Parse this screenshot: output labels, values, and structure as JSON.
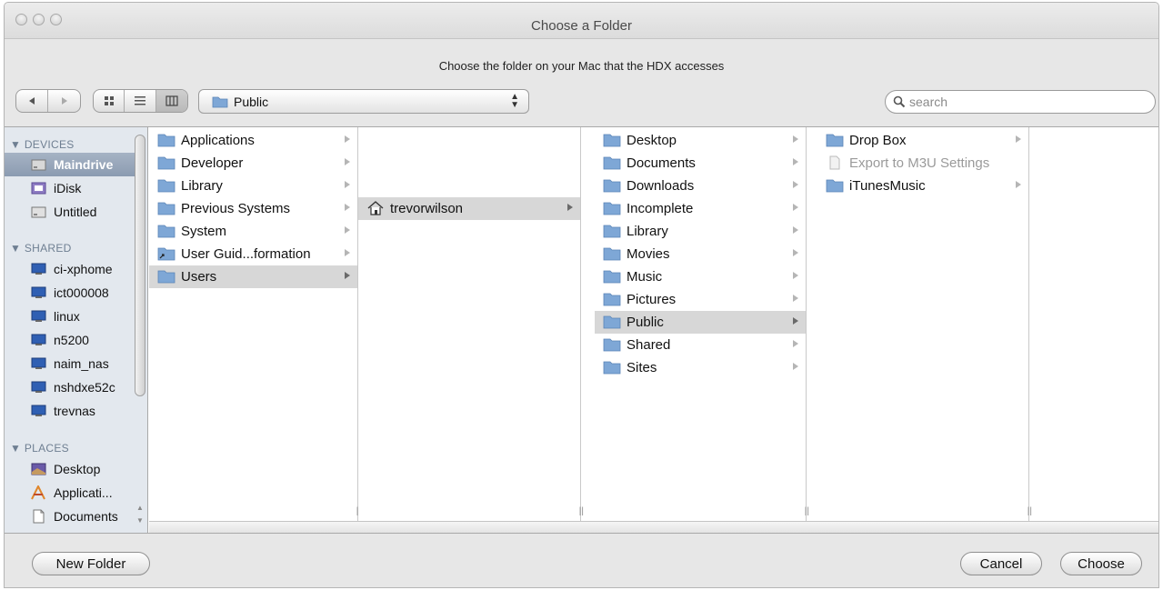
{
  "window": {
    "title": "Choose a Folder"
  },
  "subtitle": "Choose the folder on your Mac that the HDX accesses",
  "toolbar": {
    "back_icon": "back-arrow-icon",
    "forward_icon": "forward-arrow-icon",
    "view_icons": [
      "icon-view-icon",
      "list-view-icon",
      "column-view-icon"
    ],
    "location_label": "Public",
    "search_placeholder": "search"
  },
  "sidebar": {
    "devices_header": "DEVICES",
    "devices": [
      {
        "label": "Maindrive",
        "icon": "hard-drive-icon",
        "selected": true
      },
      {
        "label": "iDisk",
        "icon": "idisk-icon"
      },
      {
        "label": "Untitled",
        "icon": "hard-drive-icon"
      }
    ],
    "shared_header": "SHARED",
    "shared": [
      {
        "label": "ci-xphome",
        "icon": "network-computer-icon"
      },
      {
        "label": "ict000008",
        "icon": "network-computer-icon"
      },
      {
        "label": "linux",
        "icon": "network-computer-icon"
      },
      {
        "label": "n5200",
        "icon": "network-computer-icon"
      },
      {
        "label": "naim_nas",
        "icon": "network-computer-icon"
      },
      {
        "label": "nshdxe52c",
        "icon": "network-computer-icon"
      },
      {
        "label": "trevnas",
        "icon": "network-computer-icon"
      }
    ],
    "places_header": "PLACES",
    "places": [
      {
        "label": "Desktop",
        "icon": "desktop-icon"
      },
      {
        "label": "Applicati...",
        "icon": "applications-icon"
      },
      {
        "label": "Documents",
        "icon": "document-icon"
      }
    ]
  },
  "columns": [
    {
      "items": [
        {
          "label": "Applications",
          "arrow": true
        },
        {
          "label": "Developer",
          "arrow": true
        },
        {
          "label": "Library",
          "arrow": true
        },
        {
          "label": "Previous Systems",
          "arrow": true
        },
        {
          "label": "System",
          "arrow": true
        },
        {
          "label": "User Guid...formation",
          "arrow": true
        },
        {
          "label": "Users",
          "arrow": true,
          "selected": true
        }
      ]
    },
    {
      "items": [
        {
          "label": "trevorwilson",
          "arrow": true,
          "selected": true,
          "home": true
        }
      ]
    },
    {
      "items": [
        {
          "label": "Desktop",
          "arrow": true
        },
        {
          "label": "Documents",
          "arrow": true
        },
        {
          "label": "Downloads",
          "arrow": true
        },
        {
          "label": "Incomplete",
          "arrow": true
        },
        {
          "label": "Library",
          "arrow": true
        },
        {
          "label": "Movies",
          "arrow": true
        },
        {
          "label": "Music",
          "arrow": true
        },
        {
          "label": "Pictures",
          "arrow": true
        },
        {
          "label": "Public",
          "arrow": true,
          "selected": true
        },
        {
          "label": "Shared",
          "arrow": true
        },
        {
          "label": "Sites",
          "arrow": true
        }
      ]
    },
    {
      "items": [
        {
          "label": "Drop Box",
          "arrow": true
        },
        {
          "label": "Export to M3U Settings",
          "arrow": false,
          "dim": true
        },
        {
          "label": "iTunesMusic",
          "arrow": true
        }
      ]
    }
  ],
  "buttons": {
    "new_folder": "New Folder",
    "cancel": "Cancel",
    "choose": "Choose"
  },
  "colors": {
    "sidebar_bg": "#e3e8ee",
    "selection": "#d7d7d7",
    "sidebar_selection": "#8b9bb1",
    "folder_blue": "#7ea7d6"
  }
}
